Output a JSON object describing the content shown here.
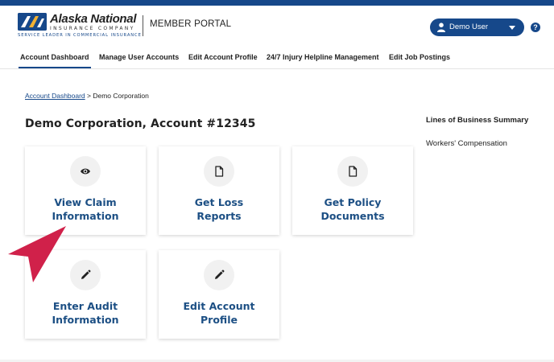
{
  "header": {
    "logo": {
      "name": "Alaska National",
      "sub": "INSURANCE COMPANY",
      "tagline": "SERVICE LEADER IN COMMERCIAL INSURANCE"
    },
    "portal_title": "MEMBER PORTAL",
    "user_name": "Demo User",
    "help_label": "?"
  },
  "nav": {
    "items": [
      {
        "label": "Account Dashboard",
        "active": true
      },
      {
        "label": "Manage User Accounts"
      },
      {
        "label": "Edit Account Profile"
      },
      {
        "label": "24/7 Injury Helpline Management"
      },
      {
        "label": "Edit Job Postings"
      }
    ]
  },
  "breadcrumb": {
    "link": "Account Dashboard",
    "separator": " > ",
    "current": "Demo Corporation"
  },
  "page_title": "Demo Corporation, Account #12345",
  "cards": [
    {
      "icon": "eye-icon",
      "line1": "View Claim",
      "line2": "Information"
    },
    {
      "icon": "document-icon",
      "line1": "Get Loss",
      "line2": "Reports"
    },
    {
      "icon": "document-icon",
      "line1": "Get Policy",
      "line2": "Documents"
    },
    {
      "icon": "pencil-icon",
      "line1": "Enter Audit",
      "line2": "Information"
    },
    {
      "icon": "pencil-icon",
      "line1": "Edit Account",
      "line2": "Profile"
    }
  ],
  "sidebar": {
    "title": "Lines of Business Summary",
    "items": [
      "Workers' Compensation"
    ]
  },
  "colors": {
    "brand": "#16488a",
    "card_label": "#1c4f84",
    "annotation_arrow": "#d0214a"
  }
}
